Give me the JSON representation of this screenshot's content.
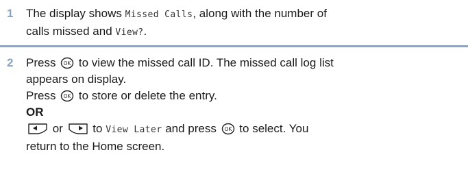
{
  "steps": [
    {
      "number": "1",
      "line1": {
        "pre": "The display shows ",
        "mono1": "Missed Calls",
        "post": ", along with the number of"
      },
      "line2": {
        "pre": "calls missed and ",
        "mono1": "View?",
        "post": "."
      }
    },
    {
      "number": "2",
      "line1": {
        "pre": "Press ",
        "post": " to view the missed call ID. The missed call log list"
      },
      "line2": "appears on display.",
      "line3": {
        "pre": "Press ",
        "post": " to store or delete the entry."
      },
      "or_label": "OR",
      "line5": {
        "mid1": " or ",
        "mid2": " to ",
        "mono1": "View Later",
        "mid3": " and press ",
        "post": " to select. You"
      },
      "line6": "return to the Home screen."
    }
  ],
  "icons": {
    "ok_key": "ok-key-icon",
    "left_key": "left-arrow-key-icon",
    "right_key": "right-arrow-key-icon"
  },
  "colors": {
    "step_number": "#8aa3c2",
    "divider": "#8fa3bc"
  }
}
